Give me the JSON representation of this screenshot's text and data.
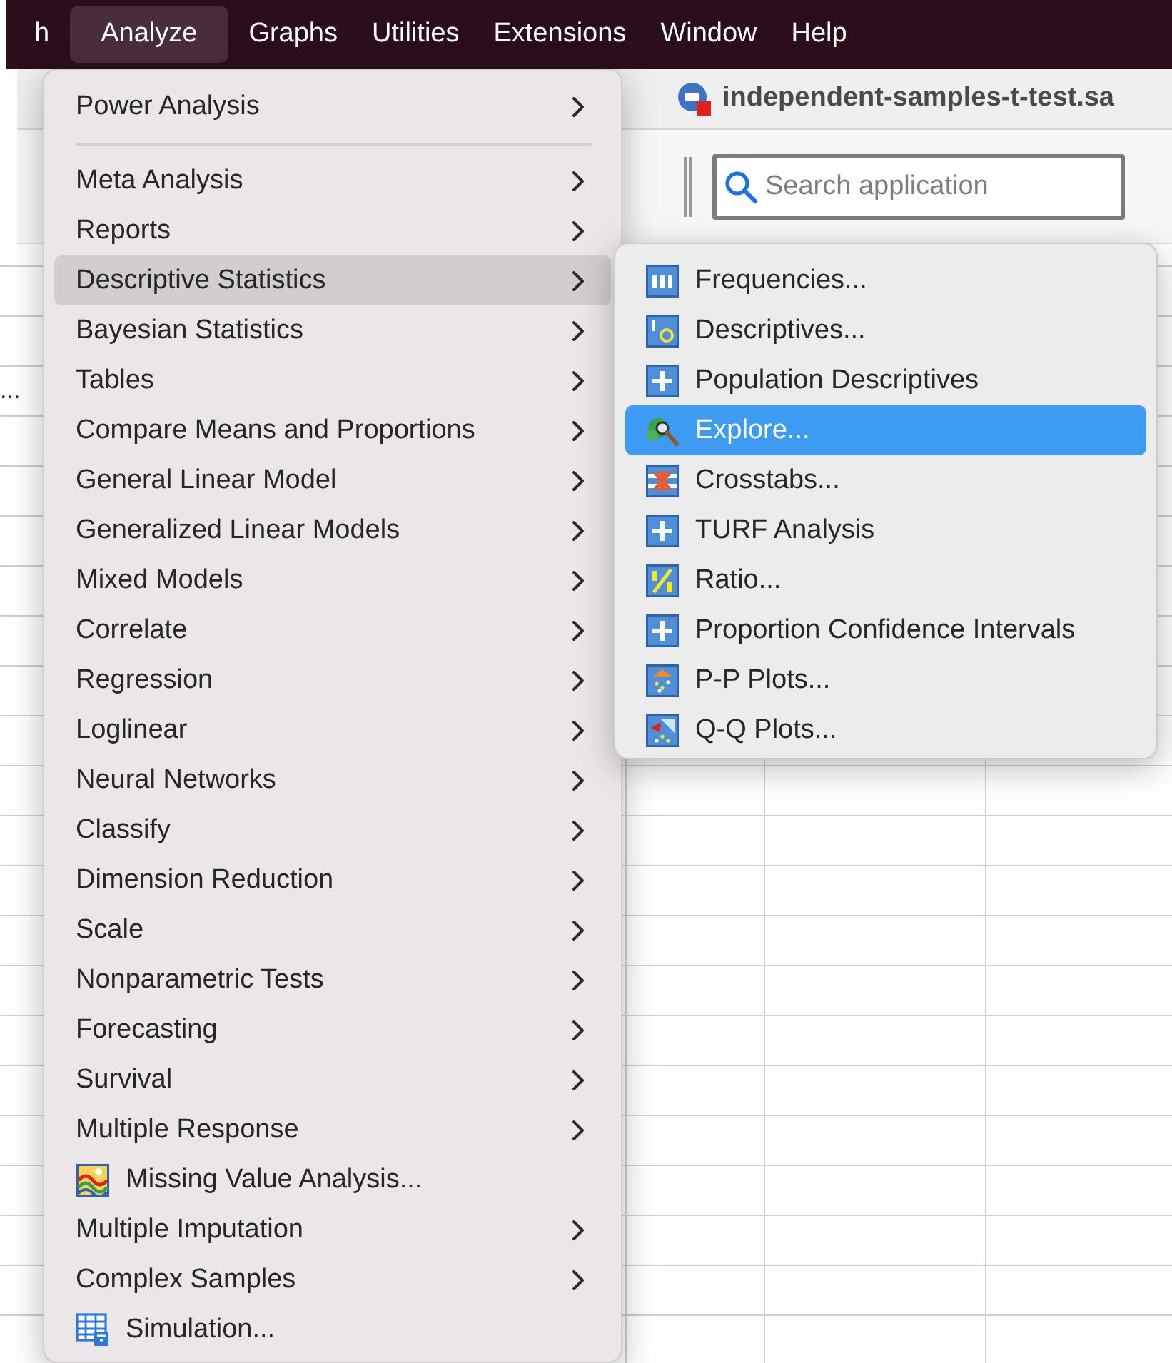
{
  "menu_bar": {
    "items": [
      {
        "label": "h",
        "selected": false
      },
      {
        "label": "Analyze",
        "selected": true
      },
      {
        "label": "Graphs",
        "selected": false
      },
      {
        "label": "Utilities",
        "selected": false
      },
      {
        "label": "Extensions",
        "selected": false
      },
      {
        "label": "Window",
        "selected": false
      },
      {
        "label": "Help",
        "selected": false
      }
    ]
  },
  "window": {
    "title": "independent-samples-t-test.sa"
  },
  "toolbar": {
    "search": {
      "placeholder": "Search application"
    }
  },
  "data_grid": {
    "cell_text": "..."
  },
  "analyze_menu": {
    "items": [
      {
        "label": "Power Analysis",
        "kind": "submenu",
        "selected": false
      },
      {
        "kind": "separator"
      },
      {
        "label": "Meta Analysis",
        "kind": "submenu",
        "selected": false
      },
      {
        "label": "Reports",
        "kind": "submenu",
        "selected": false
      },
      {
        "label": "Descriptive Statistics",
        "kind": "submenu",
        "selected": true
      },
      {
        "label": "Bayesian Statistics",
        "kind": "submenu",
        "selected": false
      },
      {
        "label": "Tables",
        "kind": "submenu",
        "selected": false
      },
      {
        "label": "Compare Means and Proportions",
        "kind": "submenu",
        "selected": false
      },
      {
        "label": "General Linear Model",
        "kind": "submenu",
        "selected": false
      },
      {
        "label": "Generalized Linear Models",
        "kind": "submenu",
        "selected": false
      },
      {
        "label": "Mixed Models",
        "kind": "submenu",
        "selected": false
      },
      {
        "label": "Correlate",
        "kind": "submenu",
        "selected": false
      },
      {
        "label": "Regression",
        "kind": "submenu",
        "selected": false
      },
      {
        "label": "Loglinear",
        "kind": "submenu",
        "selected": false
      },
      {
        "label": "Neural Networks",
        "kind": "submenu",
        "selected": false
      },
      {
        "label": "Classify",
        "kind": "submenu",
        "selected": false
      },
      {
        "label": "Dimension Reduction",
        "kind": "submenu",
        "selected": false
      },
      {
        "label": "Scale",
        "kind": "submenu",
        "selected": false
      },
      {
        "label": "Nonparametric Tests",
        "kind": "submenu",
        "selected": false
      },
      {
        "label": "Forecasting",
        "kind": "submenu",
        "selected": false
      },
      {
        "label": "Survival",
        "kind": "submenu",
        "selected": false
      },
      {
        "label": "Multiple Response",
        "kind": "submenu",
        "selected": false
      },
      {
        "label": "Missing Value Analysis...",
        "kind": "chart-action",
        "selected": false
      },
      {
        "label": "Multiple Imputation",
        "kind": "submenu",
        "selected": false
      },
      {
        "label": "Complex Samples",
        "kind": "submenu",
        "selected": false
      },
      {
        "label": "Simulation...",
        "kind": "table-action",
        "selected": false
      }
    ]
  },
  "descriptive_submenu": {
    "items": [
      {
        "label": "Frequencies...",
        "kind": "bars",
        "selected": false
      },
      {
        "label": "Descriptives...",
        "kind": "moments",
        "selected": false
      },
      {
        "label": "Population Descriptives",
        "kind": "plus",
        "selected": false
      },
      {
        "label": "Explore...",
        "kind": "explore",
        "selected": true
      },
      {
        "label": "Crosstabs...",
        "kind": "crosstab",
        "selected": false
      },
      {
        "label": "TURF Analysis",
        "kind": "plus",
        "selected": false
      },
      {
        "label": "Ratio...",
        "kind": "ratio",
        "selected": false
      },
      {
        "label": "Proportion Confidence Intervals",
        "kind": "plus",
        "selected": false
      },
      {
        "label": "P-P Plots...",
        "kind": "pp-plot",
        "selected": false
      },
      {
        "label": "Q-Q Plots...",
        "kind": "qq-plot",
        "selected": false
      }
    ]
  }
}
